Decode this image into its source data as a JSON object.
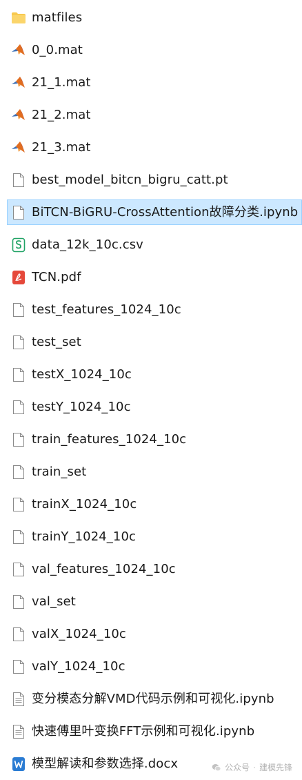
{
  "files": [
    {
      "name": "matfiles",
      "icon": "folder-icon"
    },
    {
      "name": "0_0.mat",
      "icon": "matlab-icon"
    },
    {
      "name": "21_1.mat",
      "icon": "matlab-icon"
    },
    {
      "name": "21_2.mat",
      "icon": "matlab-icon"
    },
    {
      "name": "21_3.mat",
      "icon": "matlab-icon"
    },
    {
      "name": "best_model_bitcn_bigru_catt.pt",
      "icon": "file-icon"
    },
    {
      "name": "BiTCN-BiGRU-CrossAttention故障分类.ipynb",
      "icon": "file-icon",
      "selected": true
    },
    {
      "name": "data_12k_10c.csv",
      "icon": "csv-icon"
    },
    {
      "name": "TCN.pdf",
      "icon": "pdf-icon"
    },
    {
      "name": "test_features_1024_10c",
      "icon": "file-icon"
    },
    {
      "name": "test_set",
      "icon": "file-icon"
    },
    {
      "name": "testX_1024_10c",
      "icon": "file-icon"
    },
    {
      "name": "testY_1024_10c",
      "icon": "file-icon"
    },
    {
      "name": "train_features_1024_10c",
      "icon": "file-icon"
    },
    {
      "name": "train_set",
      "icon": "file-icon"
    },
    {
      "name": "trainX_1024_10c",
      "icon": "file-icon"
    },
    {
      "name": "trainY_1024_10c",
      "icon": "file-icon"
    },
    {
      "name": "val_features_1024_10c",
      "icon": "file-icon"
    },
    {
      "name": "val_set",
      "icon": "file-icon"
    },
    {
      "name": "valX_1024_10c",
      "icon": "file-icon"
    },
    {
      "name": "valY_1024_10c",
      "icon": "file-icon"
    },
    {
      "name": "变分模态分解VMD代码示例和可视化.ipynb",
      "icon": "text-file-icon"
    },
    {
      "name": "快速傅里叶变换FFT示例和可视化.ipynb",
      "icon": "text-file-icon"
    },
    {
      "name": "模型解读和参数选择.docx",
      "icon": "word-icon"
    }
  ],
  "watermark": {
    "label": "公众号",
    "separator": "·",
    "account": "建模先锋",
    "icon": "wechat-icon"
  },
  "colors": {
    "selected_bg": "#cce8ff",
    "selected_border": "#99d1ff",
    "folder": "#f8c94f",
    "matlab": "#e16d1f",
    "csv": "#21a366",
    "pdf": "#e5483a",
    "word": "#2b7cd3"
  }
}
